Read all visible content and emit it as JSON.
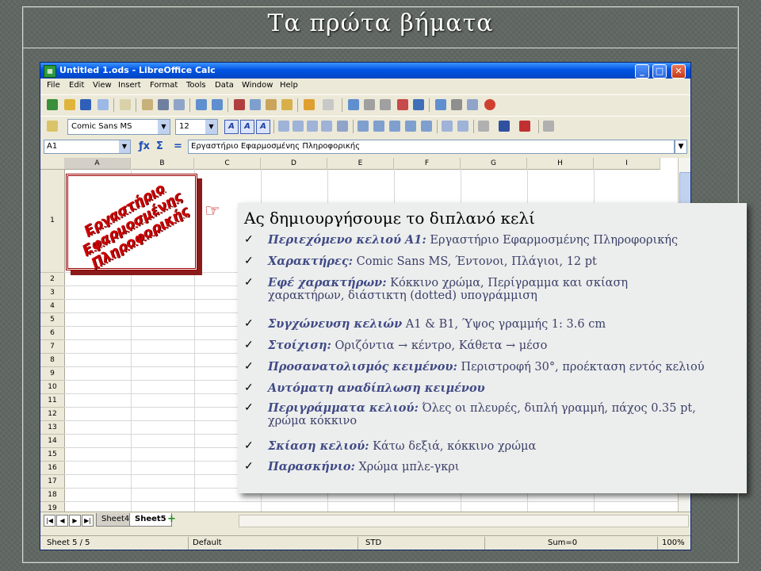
{
  "slide": {
    "title": "Τα πρώτα βήματα"
  },
  "window": {
    "title": "Untitled 1.ods - LibreOffice Calc",
    "controls": {
      "minimize": "_",
      "maximize": "□",
      "close": "✕"
    }
  },
  "menu": {
    "items": [
      "File",
      "Edit",
      "View",
      "Insert",
      "Format",
      "Tools",
      "Data",
      "Window",
      "Help"
    ],
    "close_doc": "✕"
  },
  "format_toolbar": {
    "font_name": "Comic Sans MS",
    "font_size": "12"
  },
  "formula_bar": {
    "name_box": "A1",
    "fx_label": "ƒx",
    "sum_label": "Σ",
    "eq_label": "=",
    "content": "Εργαστήριο Εφαρμοσμένης Πληροφορικής"
  },
  "grid": {
    "columns": [
      "A",
      "B",
      "C",
      "D",
      "E",
      "F",
      "G",
      "H",
      "I"
    ],
    "rows": [
      "1",
      "2",
      "3",
      "4",
      "5",
      "6",
      "7",
      "8",
      "9",
      "10",
      "11",
      "12",
      "13",
      "14",
      "15",
      "16",
      "17",
      "18",
      "19"
    ],
    "cell_a1_text": "Εργαστήριο Εφαρμοσμένης Πληροφορικής",
    "cell_a1_lines": [
      "Εργαστήριο",
      "Εφαρμοσμένης",
      "Πληροφορικής"
    ]
  },
  "sheet_tabs": {
    "tabs": [
      "Sheet4",
      "Sheet5"
    ],
    "active": "Sheet5",
    "add": "+"
  },
  "status_bar": {
    "sheet": "Sheet 5 / 5",
    "style": "Default",
    "mode": "STD",
    "sum": "Sum=0",
    "zoom": "100%"
  },
  "overlay": {
    "heading": "Ας δημιουργήσουμε το διπλανό κελί",
    "bullets": [
      {
        "label": "Περιεχόμενο κελιού A1:",
        "value": "Εργαστήριο Εφαρμοσμένης Πληροφορικής"
      },
      {
        "label": "Χαρακτήρες:",
        "value": "Comic Sans MS, Έντονοι, Πλάγιοι, 12 pt"
      },
      {
        "label": "Εφέ χαρακτήρων:",
        "value": "Κόκκινο χρώμα, Περίγραμμα και σκίαση",
        "value2": "χαρακτήρων, διάστικτη (dotted) υπογράμμιση"
      },
      {
        "label": "Συγχώνευση κελιών",
        "value": "Α1 & Β1, Ύψος γραμμής 1: 3.6 cm"
      },
      {
        "label": "Στοίχιση:",
        "value": "Οριζόντια → κέντρο, Κάθετα → μέσο"
      },
      {
        "label": "Προσανατολισμός κειμένου:",
        "value": "Περιστροφή 30°, προέκταση εντός κελιού"
      },
      {
        "label": "Αυτόματη αναδίπλωση κειμένου",
        "value": ""
      },
      {
        "label": "Περιγράμματα κελιού:",
        "value": "Όλες οι πλευρές, διπλή γραμμή, πάχος 0.35 pt,",
        "value2": "χρώμα κόκκινο"
      },
      {
        "label": "Σκίαση κελιού:",
        "value": "Κάτω δεξιά, κόκκινο χρώμα"
      },
      {
        "label": "Παρασκήνιο:",
        "value": "Χρώμα μπλε-γκρι"
      }
    ],
    "check_glyph": "✓",
    "hand_glyph": "☞"
  },
  "colors": {
    "background": "#616863",
    "title_bar": "#0054e3",
    "cell_text": "#d10000",
    "bullet_label": "#404a86"
  }
}
